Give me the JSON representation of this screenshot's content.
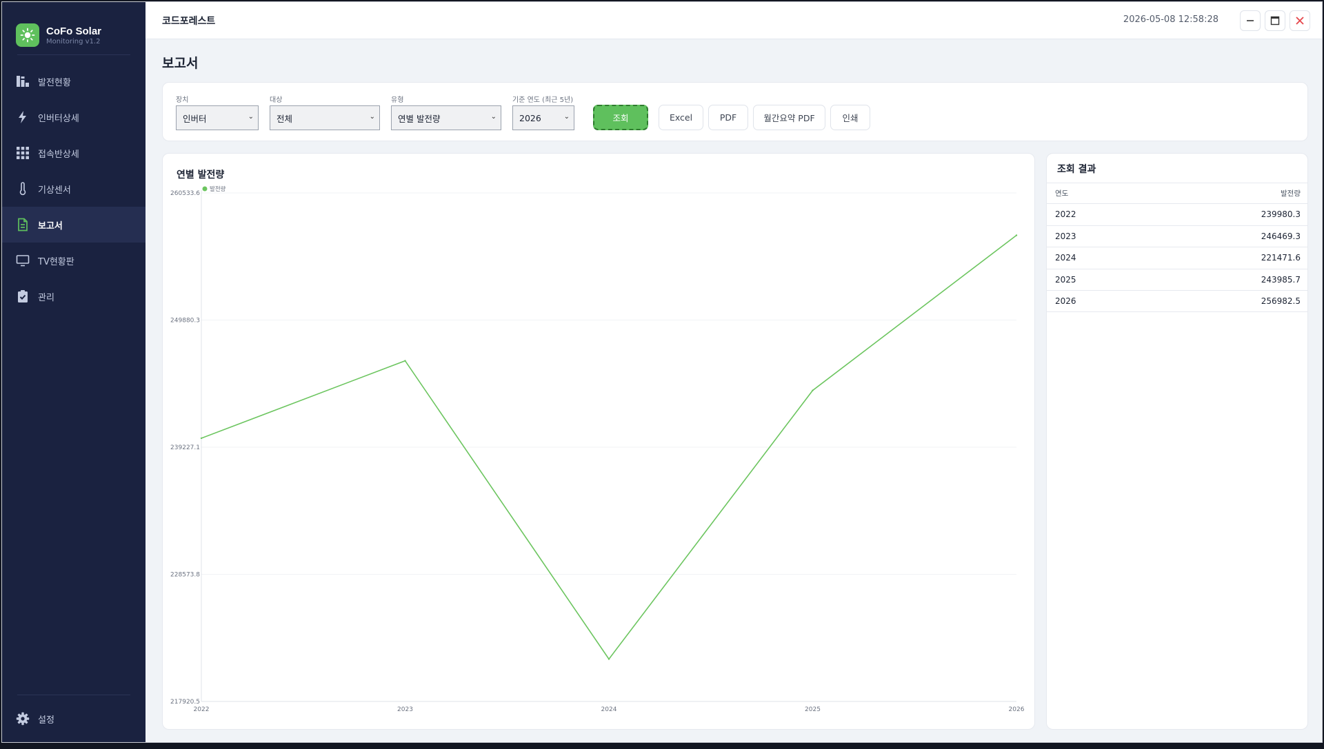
{
  "app": {
    "name": "CoFo Solar",
    "version": "Monitoring v1.2"
  },
  "sidebar": {
    "items": [
      {
        "label": "발전현황",
        "icon": "bar-chart-icon",
        "active": false
      },
      {
        "label": "인버터상세",
        "icon": "lightning-icon",
        "active": false
      },
      {
        "label": "접속반상세",
        "icon": "grid-icon",
        "active": false
      },
      {
        "label": "기상센서",
        "icon": "thermometer-icon",
        "active": false
      },
      {
        "label": "보고서",
        "icon": "document-icon",
        "active": true
      },
      {
        "label": "TV현황판",
        "icon": "monitor-icon",
        "active": false
      },
      {
        "label": "관리",
        "icon": "clipboard-check-icon",
        "active": false
      }
    ],
    "settings_label": "설정"
  },
  "topbar": {
    "title": "코드포레스트",
    "datetime": "2026-05-08  12:58:28"
  },
  "page": {
    "title": "보고서"
  },
  "filters": {
    "device": {
      "label": "장치",
      "value": "인버터"
    },
    "target": {
      "label": "대상",
      "value": "전체"
    },
    "type": {
      "label": "유형",
      "value": "연별 발전량"
    },
    "year": {
      "label": "기준 연도 (최근 5년)",
      "value": "2026"
    }
  },
  "buttons": {
    "query": "조회",
    "excel": "Excel",
    "pdf": "PDF",
    "monthly_pdf": "월간요약 PDF",
    "print": "인쇄"
  },
  "chart_panel": {
    "title": "연별 발전량"
  },
  "chart_data": {
    "type": "line",
    "title": "연별 발전량",
    "categories": [
      "2022",
      "2023",
      "2024",
      "2025",
      "2026"
    ],
    "series": [
      {
        "name": "발전량",
        "color": "#6cc55f",
        "values": [
          239980.3,
          246469.3,
          221471.6,
          243985.7,
          256982.5
        ]
      }
    ],
    "ylim": [
      217920.5,
      260533.6
    ],
    "yticks": [
      "260533.6",
      "249880.3",
      "239227.1",
      "228573.8",
      "217920.5"
    ],
    "grid": true,
    "legend": "top-left"
  },
  "result": {
    "title": "조회 결과",
    "columns": [
      "연도",
      "발전량"
    ],
    "rows": [
      [
        "2022",
        "239980.3"
      ],
      [
        "2023",
        "246469.3"
      ],
      [
        "2024",
        "221471.6"
      ],
      [
        "2025",
        "243985.7"
      ],
      [
        "2026",
        "256982.5"
      ]
    ]
  },
  "colors": {
    "accent": "#5fc05d",
    "sidebar": "#1a2240",
    "close": "#e5484d"
  }
}
